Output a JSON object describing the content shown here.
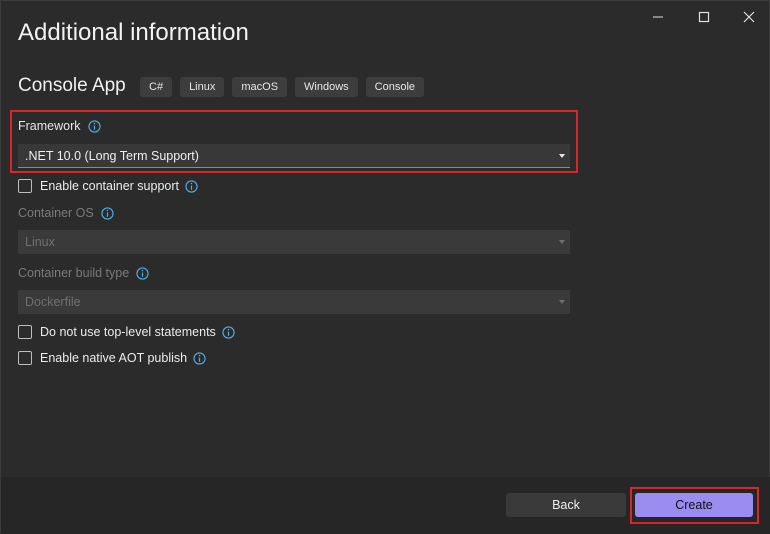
{
  "window": {
    "controls": {
      "minimize": "minimize-icon",
      "maximize": "maximize-icon",
      "close": "close-icon"
    }
  },
  "page": {
    "title": "Additional information",
    "template_name": "Console App",
    "tags": [
      "C#",
      "Linux",
      "macOS",
      "Windows",
      "Console"
    ]
  },
  "framework": {
    "label": "Framework",
    "value": ".NET 10.0 (Long Term Support)"
  },
  "container_support": {
    "label": "Enable container support",
    "checked": false
  },
  "container_os": {
    "label": "Container OS",
    "value": "Linux",
    "disabled": true
  },
  "container_build_type": {
    "label": "Container build type",
    "value": "Dockerfile",
    "disabled": true
  },
  "top_level_statements": {
    "label": "Do not use top-level statements",
    "checked": false
  },
  "native_aot": {
    "label": "Enable native AOT publish",
    "checked": false
  },
  "footer": {
    "back_label": "Back",
    "create_label": "Create"
  },
  "colors": {
    "accent": "#9b8cf2",
    "highlight": "#d6262b",
    "info_icon": "#4fb0e8"
  }
}
